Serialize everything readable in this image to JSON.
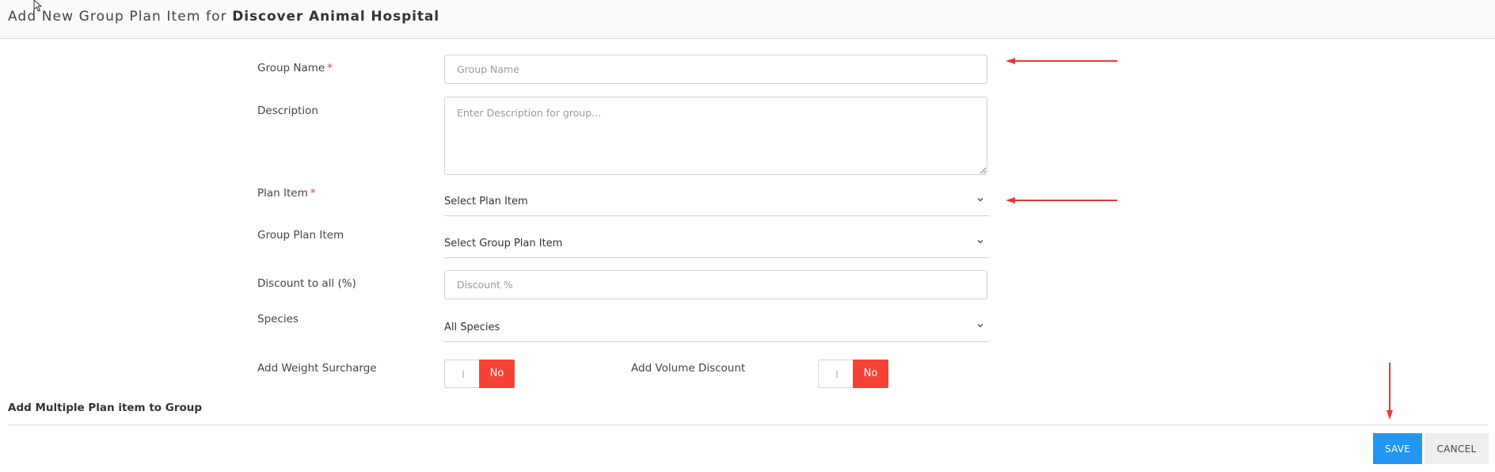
{
  "header": {
    "title_prefix": "Add New Group Plan Item for ",
    "title_clinic": "Discover Animal Hospital"
  },
  "form": {
    "group_name": {
      "label": "Group Name",
      "required_mark": "*",
      "placeholder": "Group Name",
      "value": ""
    },
    "description": {
      "label": "Description",
      "placeholder": "Enter Description for group...",
      "value": ""
    },
    "plan_item": {
      "label": "Plan Item",
      "required_mark": "*",
      "selected": "Select Plan Item"
    },
    "group_plan_item": {
      "label": "Group Plan Item",
      "selected": "Select Group Plan Item"
    },
    "discount": {
      "label": "Discount to all (%)",
      "placeholder": "Discount %",
      "value": ""
    },
    "species": {
      "label": "Species",
      "selected": "All Species"
    },
    "weight_surcharge": {
      "label": "Add Weight Surcharge",
      "state": "No"
    },
    "volume_discount": {
      "label": "Add Volume Discount",
      "state": "No"
    }
  },
  "section": {
    "title": "Add Multiple Plan item to Group"
  },
  "actions": {
    "save_label": "SAVE",
    "cancel_label": "CANCEL"
  },
  "colors": {
    "primary": "#2196f3",
    "danger": "#f44336",
    "annotation": "#e53935"
  },
  "icons": {
    "dropdown": "chevron-down-icon",
    "cursor": "mouse-pointer-icon"
  }
}
